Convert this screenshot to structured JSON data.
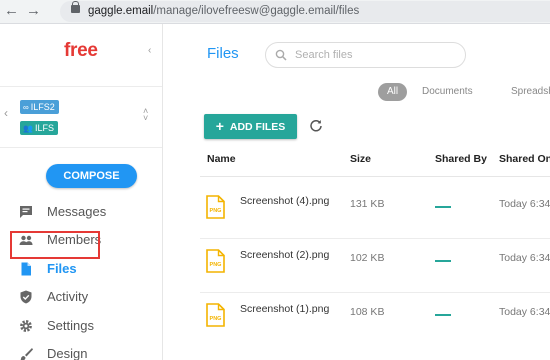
{
  "browser": {
    "back_icon": "arrow-left-icon",
    "forward_icon": "arrow-right-icon",
    "url_host": "gaggle.email",
    "url_path": "/manage/ilovefreesw@gaggle.email/files"
  },
  "sidebar": {
    "logo": "free",
    "collapse_glyph": "‹",
    "accounts": [
      {
        "label": "ILFS2",
        "icon": "link-icon",
        "color": "#4a9fd8"
      },
      {
        "label": "ILFS",
        "icon": "group-icon",
        "color": "#26a69a"
      }
    ],
    "compose_label": "COMPOSE",
    "nav": [
      {
        "label": "Messages",
        "icon": "message-icon"
      },
      {
        "label": "Members",
        "icon": "members-icon"
      },
      {
        "label": "Files",
        "icon": "file-icon",
        "active": true
      },
      {
        "label": "Activity",
        "icon": "shield-icon"
      },
      {
        "label": "Settings",
        "icon": "gear-icon"
      },
      {
        "label": "Design",
        "icon": "brush-icon"
      }
    ]
  },
  "main": {
    "title": "Files",
    "search_placeholder": "Search files",
    "filters": [
      "All",
      "Documents",
      "Spreadsheets"
    ],
    "add_files_label": "ADD FILES",
    "columns": [
      "Name",
      "Size",
      "Shared By",
      "Shared On"
    ],
    "files": [
      {
        "name": "Screenshot (4).png",
        "size": "131 KB",
        "shared_on": "Today 6:34"
      },
      {
        "name": "Screenshot (2).png",
        "size": "102 KB",
        "shared_on": "Today 6:34"
      },
      {
        "name": "Screenshot (1).png",
        "size": "108 KB",
        "shared_on": "Today 6:34"
      }
    ],
    "file_icon_label": "PNG"
  },
  "colors": {
    "primary": "#2196f3",
    "accent": "#26a69a",
    "brand_red": "#e53935"
  }
}
